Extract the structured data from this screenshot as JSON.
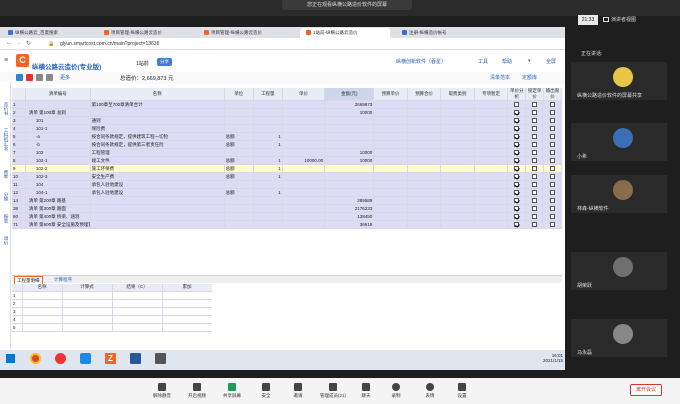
{
  "meeting": {
    "viewing_text": "您正在观看纵横公路造价软件的屏幕",
    "time": "21:33",
    "speaker_view": "演讲者视图",
    "speaking_label": "正在讲话:",
    "participants": [
      {
        "name": "纵横公路造价软件的屏幕共享"
      },
      {
        "name": "小希"
      },
      {
        "name": "林森-纵横软件"
      },
      {
        "name": "胡荣跃"
      },
      {
        "name": "马永磊"
      }
    ],
    "bottom_buttons": [
      {
        "label": "解除静音",
        "icon": "mic-icon"
      },
      {
        "label": "开启视频",
        "icon": "camera-icon"
      },
      {
        "label": "共享屏幕",
        "icon": "share-screen-icon"
      },
      {
        "label": "安全",
        "icon": "shield-icon"
      },
      {
        "label": "邀请",
        "icon": "invite-icon"
      },
      {
        "label": "管理成员(21)",
        "icon": "members-icon"
      },
      {
        "label": "聊天",
        "icon": "chat-icon"
      },
      {
        "label": "录制",
        "icon": "record-icon"
      },
      {
        "label": "表情",
        "icon": "emoji-icon"
      },
      {
        "label": "设置",
        "icon": "settings-icon"
      }
    ],
    "end_button": "离开会议"
  },
  "browser": {
    "tabs": [
      {
        "label": "纵横公路云_百度搜索"
      },
      {
        "label": "项目管理-纵横公路云造价"
      },
      {
        "label": "项目管理-纵横公路云造价"
      },
      {
        "label": "1站前-纵横公路云造价"
      },
      {
        "label": "注册-纵横造价帐号"
      }
    ],
    "url": "glyun.smartcost.com.cn/main?project=13636"
  },
  "app": {
    "product": "纵横公路云造价(专业版)",
    "doc_name": "1站前",
    "share": "分享",
    "total_label": "总造价：2,669,873 元",
    "user": "纵横创新软件（吞星）",
    "tools": "工具",
    "help": "帮助",
    "full_screen": "全屏",
    "more": "更多",
    "right_links": [
      "清单范本",
      "定额库"
    ],
    "left_nav": [
      "造价书",
      "工料机汇总",
      "费率",
      "分摊",
      "报表",
      "调价"
    ],
    "columns": [
      "",
      "清单编号",
      "名称",
      "单位",
      "工程量",
      "单价",
      "金额(元)",
      "预算单价",
      "预算合价",
      "取费类别",
      "专项暂定",
      "单价分析",
      "锁定单价",
      "输出限价"
    ],
    "rows": [
      {
        "idx": "1",
        "code": "",
        "name": "第100章至700章清单合计",
        "unit": "",
        "qty": "",
        "price": "",
        "amt": "2669873",
        "c1": false,
        "c2": false,
        "c3": false,
        "style": "lav"
      },
      {
        "idx": "2",
        "code": "清单 第100章 总则",
        "name": "",
        "unit": "",
        "qty": "",
        "price": "",
        "amt": "10000",
        "c1": true,
        "c2": false,
        "c3": false,
        "style": "lav"
      },
      {
        "idx": "3",
        "code": "101",
        "name": "通则",
        "unit": "",
        "qty": "",
        "price": "",
        "amt": "",
        "c1": true,
        "c2": false,
        "c3": false,
        "style": "lav"
      },
      {
        "idx": "4",
        "code": "101-1",
        "name": "保险费",
        "unit": "",
        "qty": "",
        "price": "",
        "amt": "",
        "c1": true,
        "c2": false,
        "c3": false,
        "style": "lav"
      },
      {
        "idx": "5",
        "code": "-a",
        "name": "按合同条款规定，提供建筑工程一切险",
        "unit": "总额",
        "qty": "1",
        "price": "",
        "amt": "",
        "c1": true,
        "c2": false,
        "c3": false,
        "style": "lav"
      },
      {
        "idx": "6",
        "code": "-b",
        "name": "按合同条款规定，提供第三者责任险",
        "unit": "总额",
        "qty": "1",
        "price": "",
        "amt": "",
        "c1": true,
        "c2": false,
        "c3": false,
        "style": "lav"
      },
      {
        "idx": "7",
        "code": "102",
        "name": "工程管理",
        "unit": "",
        "qty": "",
        "price": "",
        "amt": "10000",
        "c1": true,
        "c2": false,
        "c3": false,
        "style": "lav"
      },
      {
        "idx": "8",
        "code": "102-1",
        "name": "竣工文件",
        "unit": "总额",
        "qty": "1",
        "price": "10000.00",
        "amt": "10000",
        "c1": true,
        "c2": false,
        "c3": false,
        "style": "lav"
      },
      {
        "idx": "9",
        "code": "102-2",
        "name": "施工环保费",
        "unit": "总额",
        "qty": "1",
        "price": "",
        "amt": "",
        "c1": true,
        "c2": false,
        "c3": false,
        "style": "yel"
      },
      {
        "idx": "10",
        "code": "102-3",
        "name": "安全生产费",
        "unit": "总额",
        "qty": "1",
        "price": "",
        "amt": "",
        "c1": true,
        "c2": false,
        "c3": false,
        "style": "lav"
      },
      {
        "idx": "11",
        "code": "104",
        "name": "承包人驻地建设",
        "unit": "",
        "qty": "",
        "price": "",
        "amt": "",
        "c1": true,
        "c2": false,
        "c3": false,
        "style": "lav"
      },
      {
        "idx": "12",
        "code": "104-1",
        "name": "承包人驻地建设",
        "unit": "总额",
        "qty": "1",
        "price": "",
        "amt": "",
        "c1": true,
        "c2": false,
        "c3": false,
        "style": "lav"
      },
      {
        "idx": "14",
        "code": "清单 第200章 路基",
        "name": "",
        "unit": "",
        "qty": "",
        "price": "",
        "amt": "289589",
        "c1": true,
        "c2": false,
        "c3": false,
        "style": "lav"
      },
      {
        "idx": "38",
        "code": "清单 第300章 路面",
        "name": "",
        "unit": "",
        "qty": "",
        "price": "",
        "amt": "2176233",
        "c1": true,
        "c2": false,
        "c3": false,
        "style": "lav"
      },
      {
        "idx": "60",
        "code": "清单 第400章 桥梁、涵洞",
        "name": "",
        "unit": "",
        "qty": "",
        "price": "",
        "amt": "138450",
        "c1": true,
        "c2": false,
        "c3": false,
        "style": "lav"
      },
      {
        "idx": "71",
        "code": "清单 第600章 安全设施及预埋管线",
        "name": "",
        "unit": "",
        "qty": "",
        "price": "",
        "amt": "36618",
        "c1": true,
        "c2": false,
        "c3": false,
        "style": "lav"
      }
    ],
    "lower_tabs": [
      "工程量明细",
      "计算程序"
    ],
    "lower_columns": [
      "",
      "名称",
      "计算式",
      "结果（C）",
      "累加"
    ],
    "lower_rows": [
      "1",
      "2",
      "3",
      "4",
      "5"
    ]
  },
  "taskbar": {
    "time": "16:01",
    "date": "2021/1/15"
  }
}
